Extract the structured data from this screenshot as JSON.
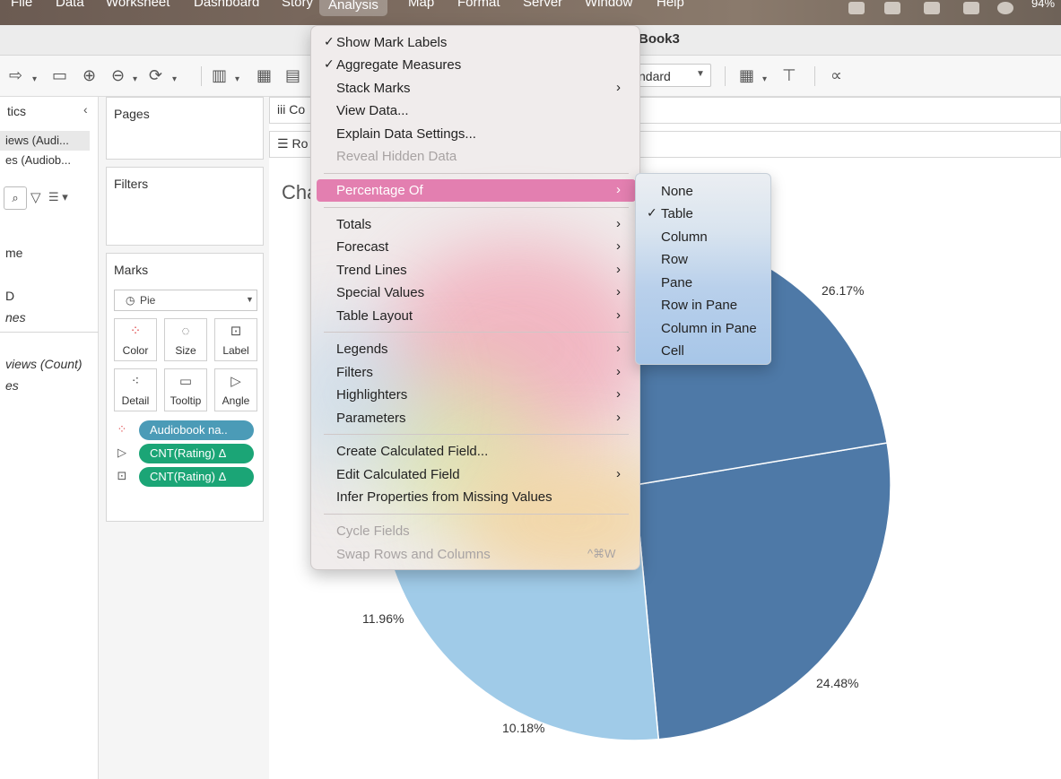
{
  "menubar": {
    "items": [
      "File",
      "Data",
      "Worksheet",
      "Dashboard",
      "Story",
      "Analysis",
      "Map",
      "Format",
      "Server",
      "Window",
      "Help"
    ],
    "active": "Analysis",
    "battery": "94%"
  },
  "window": {
    "title": "Book3"
  },
  "toolbar": {
    "fit_value": "ndard"
  },
  "data_pane": {
    "header": "tics",
    "sources": [
      "iews (Audi...",
      "es (Audiob..."
    ],
    "fields": [
      "me",
      "D",
      "nes",
      "views (Count)",
      "es"
    ]
  },
  "pages": {
    "title": "Pages"
  },
  "filters": {
    "title": "Filters"
  },
  "marks": {
    "title": "Marks",
    "type": "Pie",
    "buttons": [
      {
        "label": "Color",
        "icon": "color-dots-icon"
      },
      {
        "label": "Size",
        "icon": "size-icon"
      },
      {
        "label": "Label",
        "icon": "label-icon"
      },
      {
        "label": "Detail",
        "icon": "detail-icon"
      },
      {
        "label": "Tooltip",
        "icon": "tooltip-icon"
      },
      {
        "label": "Angle",
        "icon": "angle-icon"
      }
    ],
    "pills": [
      {
        "label": "Audiobook na..",
        "kind": "color",
        "color": "#4b9bb7"
      },
      {
        "label": "CNT(Rating)  Δ",
        "kind": "angle",
        "color": "#1ba576"
      },
      {
        "label": "CNT(Rating)  Δ",
        "kind": "label",
        "color": "#1ba576"
      }
    ]
  },
  "shelves": {
    "columns_label": "Co",
    "rows_label": "Ro"
  },
  "view": {
    "title_fragment": "Cha"
  },
  "chart_data": {
    "type": "pie",
    "values": [
      26.17,
      24.48,
      10.18,
      11.96,
      27.21
    ],
    "labels": [
      "26.17%",
      "24.48%",
      "10.18%",
      "11.96%",
      ""
    ],
    "colors": [
      "#4e79a7",
      "#a0cbe8",
      "#f28e2b",
      "#ffbe7d",
      "#4e79a7"
    ]
  },
  "analysis_menu": {
    "items": [
      {
        "label": "Show Mark Labels",
        "checked": true
      },
      {
        "label": "Aggregate Measures",
        "checked": true
      },
      {
        "label": "Stack Marks",
        "submenu": true
      },
      {
        "label": "View Data..."
      },
      {
        "label": "Explain Data Settings..."
      },
      {
        "label": "Reveal Hidden Data",
        "disabled": true
      },
      {
        "label": "Percentage Of",
        "submenu": true,
        "highlighted": true
      },
      {
        "label": "Totals",
        "submenu": true
      },
      {
        "label": "Forecast",
        "submenu": true
      },
      {
        "label": "Trend Lines",
        "submenu": true
      },
      {
        "label": "Special Values",
        "submenu": true
      },
      {
        "label": "Table Layout",
        "submenu": true
      },
      {
        "label": "Legends",
        "submenu": true
      },
      {
        "label": "Filters",
        "submenu": true
      },
      {
        "label": "Highlighters",
        "submenu": true
      },
      {
        "label": "Parameters",
        "submenu": true
      },
      {
        "label": "Create Calculated Field..."
      },
      {
        "label": "Edit Calculated Field",
        "submenu": true
      },
      {
        "label": "Infer Properties from Missing Values"
      },
      {
        "label": "Cycle Fields",
        "disabled": true
      },
      {
        "label": "Swap Rows and Columns",
        "disabled": true,
        "shortcut": "^⌘W"
      }
    ]
  },
  "percentage_submenu": {
    "items": [
      {
        "label": "None"
      },
      {
        "label": "Table",
        "checked": true
      },
      {
        "label": "Column"
      },
      {
        "label": "Row"
      },
      {
        "label": "Pane"
      },
      {
        "label": "Row in Pane"
      },
      {
        "label": "Column in Pane"
      },
      {
        "label": "Cell"
      }
    ]
  }
}
